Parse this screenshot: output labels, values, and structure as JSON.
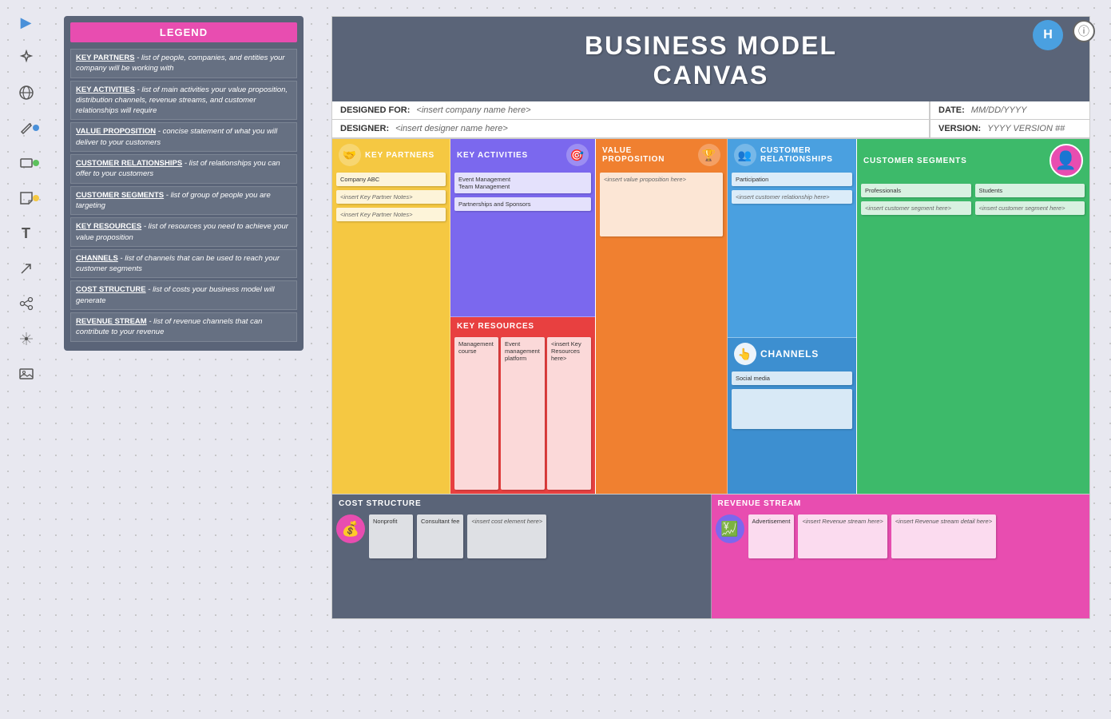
{
  "app": {
    "title": "Business Model Canvas",
    "user_initial": "H"
  },
  "toolbar": {
    "icons": [
      {
        "name": "play-icon",
        "symbol": "▶",
        "active": true
      },
      {
        "name": "magic-icon",
        "symbol": "✦"
      },
      {
        "name": "globe-icon",
        "symbol": "⊕"
      },
      {
        "name": "pencil-icon",
        "symbol": "✎"
      },
      {
        "name": "rectangle-icon",
        "symbol": "□"
      },
      {
        "name": "note-icon",
        "symbol": "🗒"
      },
      {
        "name": "text-icon",
        "symbol": "T"
      },
      {
        "name": "arrow-icon",
        "symbol": "↗"
      },
      {
        "name": "flow-icon",
        "symbol": "⬡"
      },
      {
        "name": "star-icon",
        "symbol": "✦"
      },
      {
        "name": "image-icon",
        "symbol": "🖼"
      }
    ]
  },
  "legend": {
    "title": "LEGEND",
    "items": [
      {
        "key": "KEY PARTNERS",
        "desc": " - list of people, companies, and entities your company will be working with"
      },
      {
        "key": "KEY ACTIVITIES",
        "desc": " - list of main activities your value proposition, distribution channels, revenue streams, and customer relationships will require"
      },
      {
        "key": "VALUE PROPOSITION",
        "desc": "- concise statement of what you will deliver to your customers"
      },
      {
        "key": "CUSTOMER RELATIONSHIPS",
        "desc": " - list of relationships you can offer to your customers"
      },
      {
        "key": "CUSTOMER SEGMENTS",
        "desc": " - list of group of people you are targeting"
      },
      {
        "key": "KEY RESOURCES",
        "desc": " - list of resources you need to achieve your value proposition"
      },
      {
        "key": "CHANNELS",
        "desc": " - list of channels that can be used to reach your customer segments"
      },
      {
        "key": "COST STRUCTURE",
        "desc": " - list of costs your business model will generate"
      },
      {
        "key": "REVENUE STREAM",
        "desc": " - list of revenue channels that can contribute to your revenue"
      }
    ]
  },
  "header": {
    "title": "BUSINESS MODEL",
    "subtitle": "CANVAS"
  },
  "meta": {
    "designed_for_label": "DESIGNED FOR:",
    "designed_for_value": "<insert company name here>",
    "designer_label": "DESIGNER:",
    "designer_value": "<insert designer name here>",
    "date_label": "DATE:",
    "date_value": "MM/DD/YYYY",
    "version_label": "VERSION:",
    "version_value": "YYYY VERSION ##"
  },
  "sections": {
    "key_partners": {
      "title": "KEY PARTNERS",
      "icon": "🤝",
      "notes": [
        {
          "text": "Company ABC"
        },
        {
          "text": "<insert Key Partner Notes>"
        },
        {
          "text": "<insert Key Partner Notes>"
        }
      ]
    },
    "key_activities": {
      "title": "KEY ACTIVITIES",
      "icon": "🎯",
      "notes": [
        {
          "text": "Event Management\nTeam Management"
        },
        {
          "text": "Partnerships and Sponsors"
        }
      ]
    },
    "value_proposition": {
      "title": "VALUE PROPOSITION",
      "icon": "🏆",
      "notes": [
        {
          "text": "<insert value proposition here>"
        }
      ]
    },
    "customer_relationships": {
      "title": "CUSTOMER RELATIONSHIPS",
      "icon": "👥",
      "notes": [
        {
          "text": "Participation"
        },
        {
          "text": "<insert customer relationship here>"
        }
      ]
    },
    "customer_segments": {
      "title": "CUSTOMER SEGMENTS",
      "icon": "👤",
      "notes": [
        {
          "text": "Professionals"
        },
        {
          "text": "Students"
        },
        {
          "text": "<insert customer segment here>"
        },
        {
          "text": "<insert customer segment here>"
        }
      ]
    },
    "key_resources": {
      "title": "KEY RESOURCES",
      "notes": [
        {
          "text": "Management course"
        },
        {
          "text": "Event management platform"
        },
        {
          "text": "<insert Key Resources here>"
        }
      ]
    },
    "channels": {
      "title": "CHANNELS",
      "icon": "👆",
      "notes": [
        {
          "text": "Social media"
        },
        {
          "text": ""
        }
      ]
    },
    "cost_structure": {
      "title": "COST STRUCTURE",
      "icon": "💰",
      "notes": [
        {
          "text": "Nonprofit"
        },
        {
          "text": "Consultant fee"
        },
        {
          "text": "<insert cost element here>"
        }
      ]
    },
    "revenue_stream": {
      "title": "REVENUE STREAM",
      "icon": "💹",
      "notes": [
        {
          "text": "Advertisement"
        },
        {
          "text": "<insert Revenue stream here>"
        },
        {
          "text": "<insert Revenue stream detail here>"
        }
      ]
    }
  }
}
